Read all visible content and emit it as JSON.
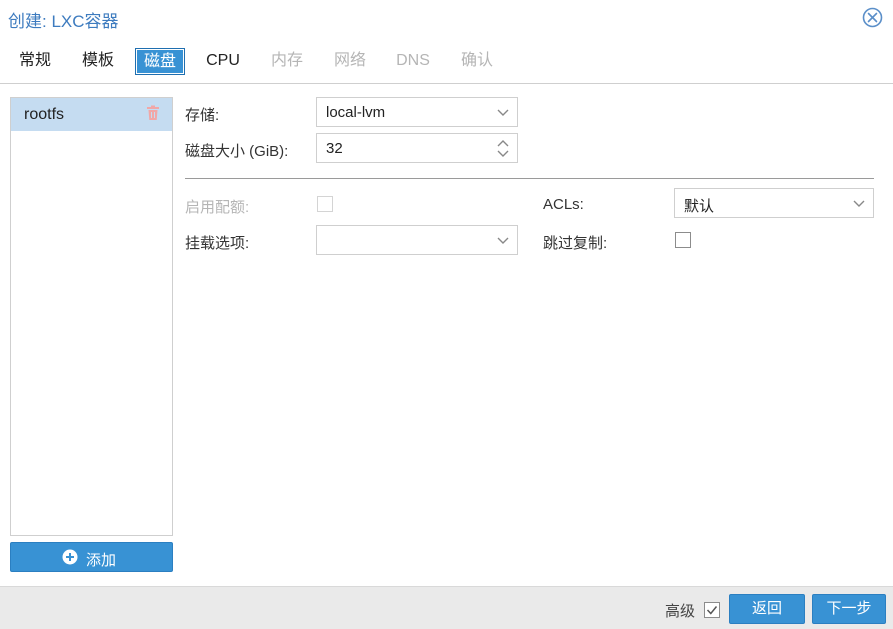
{
  "window": {
    "title": "创建: LXC容器"
  },
  "tabs": [
    {
      "label": "常规",
      "state": "normal"
    },
    {
      "label": "模板",
      "state": "normal"
    },
    {
      "label": "磁盘",
      "state": "active"
    },
    {
      "label": "CPU",
      "state": "normal"
    },
    {
      "label": "内存",
      "state": "disabled"
    },
    {
      "label": "网络",
      "state": "disabled"
    },
    {
      "label": "DNS",
      "state": "disabled"
    },
    {
      "label": "确认",
      "state": "disabled"
    }
  ],
  "disks": {
    "items": [
      {
        "label": "rootfs",
        "selected": true
      }
    ],
    "add_label": "添加"
  },
  "form": {
    "storage": {
      "label": "存储:",
      "value": "local-lvm"
    },
    "disk_size": {
      "label": "磁盘大小 (GiB):",
      "value": "32"
    },
    "quota": {
      "label": "启用配额:",
      "checked": false,
      "disabled": true
    },
    "acls": {
      "label": "ACLs:",
      "value": "默认"
    },
    "mount_options": {
      "label": "挂载选项:",
      "value": ""
    },
    "skip_replication": {
      "label": "跳过复制:",
      "checked": false
    }
  },
  "footer": {
    "advanced_label": "高级",
    "advanced_checked": true,
    "back_label": "返回",
    "next_label": "下一步"
  },
  "colors": {
    "accent": "#3892d4",
    "title": "#3d7bbf",
    "selected_row": "#c5dcf1",
    "trash": "#f1a7a7",
    "disabled_text": "#b5b5b5"
  }
}
